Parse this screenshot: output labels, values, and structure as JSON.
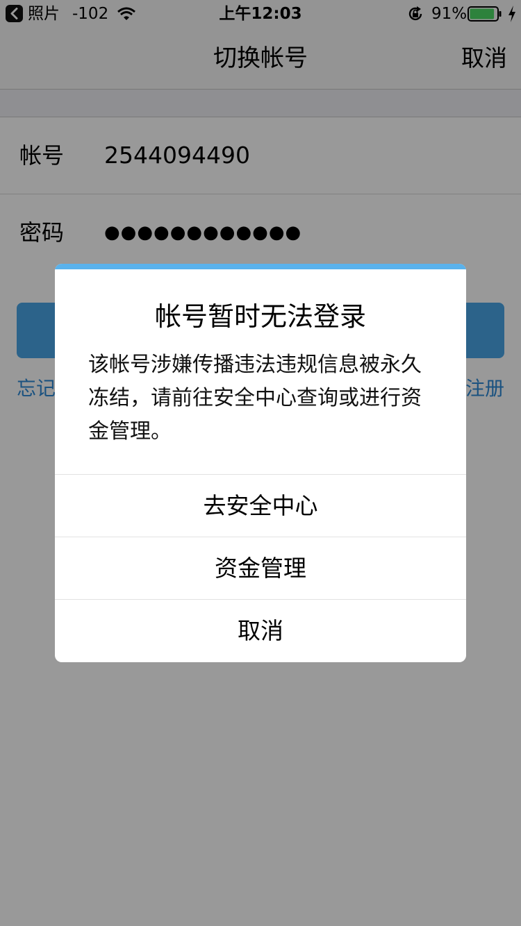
{
  "status_bar": {
    "back_app": "照片",
    "signal": "-102",
    "time": "上午12:03",
    "battery_percent": "91%",
    "battery_level": 0.91,
    "battery_color": "#4cd964"
  },
  "nav": {
    "title": "切换帐号",
    "cancel_label": "取消"
  },
  "form": {
    "account_label": "帐号",
    "account_value": "2544094490",
    "password_label": "密码",
    "password_value": "●●●●●●●●●●●●"
  },
  "login": {
    "button_color": "#4aa6e6",
    "link_left": "忘记",
    "link_right": "注册"
  },
  "alert": {
    "title": "帐号暂时无法登录",
    "message": "该帐号涉嫌传播违法违规信息被永久冻结，请前往安全中心查询或进行资金管理。",
    "buttons": {
      "security_center": "去安全中心",
      "funds_management": "资金管理",
      "cancel": "取消"
    },
    "accent_color": "#5ab2ec"
  }
}
